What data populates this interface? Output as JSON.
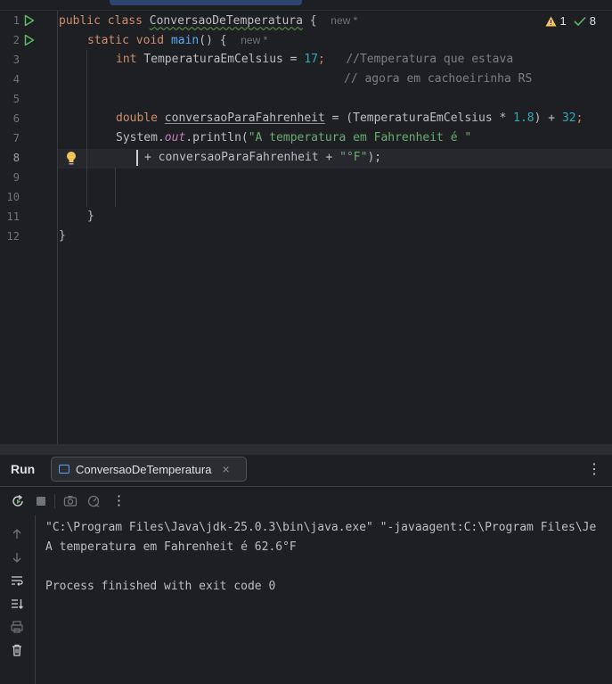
{
  "editor": {
    "line_numbers": [
      "1",
      "2",
      "3",
      "4",
      "5",
      "6",
      "7",
      "8",
      "9",
      "10",
      "11",
      "12"
    ],
    "current_line": "8",
    "lines": {
      "l1": {
        "kw_public": "public",
        "kw_class": "class",
        "class_name": "ConversaoDeTemperatura",
        "brace": "{",
        "hint": "new *"
      },
      "l2": {
        "kw_static": "static",
        "kw_void": "void",
        "method": "main",
        "rest": "() {",
        "hint": "new *"
      },
      "l3": {
        "kw_int": "int",
        "var": "TemperaturaEmCelsius",
        "eq": " = ",
        "num": "17",
        "semi": ";",
        "comment": "//Temperatura que estava"
      },
      "l4": {
        "comment": "// agora em cachoeirinha RS"
      },
      "l6": {
        "kw_double": "double",
        "var": "conversaoParaFahrenheit",
        "eq": " = (",
        "var2": "TemperaturaEmCelsius",
        "op": " * ",
        "num1": "1.8",
        "mid": ") + ",
        "num2": "32",
        "semi": ";"
      },
      "l7": {
        "sys": "System.",
        "out": "out",
        "println": ".println(",
        "str": "\"A temperatura em Fahrenheit é \""
      },
      "l8": {
        "plus": "+ conversaoParaFahrenheit + ",
        "str": "\"°F\"",
        "end": ");"
      },
      "l11": {
        "brace": "}"
      },
      "l12": {
        "brace": "}"
      }
    },
    "inspections": {
      "warnings": "1",
      "ok": "8"
    }
  },
  "run_panel": {
    "title": "Run",
    "tab_label": "ConversaoDeTemperatura",
    "tab_close": "×",
    "more": "⋮",
    "console": [
      "\"C:\\Program Files\\Java\\jdk-25.0.3\\bin\\java.exe\" \"-javaagent:C:\\Program Files\\Je",
      "A temperatura em Fahrenheit é 62.6°F",
      "",
      "Process finished with exit code 0"
    ]
  },
  "colors": {
    "bg": "#1e1f22",
    "keyword": "#cf8e6d",
    "string": "#6aab73",
    "number": "#2aacb8",
    "method": "#56a8f5",
    "comment": "#7a7e85",
    "run_green": "#5fb865"
  },
  "icons": [
    "run-gutter-icon",
    "intention-bulb-icon",
    "warning-icon",
    "check-icon",
    "rerun-icon",
    "stop-icon",
    "camera-icon",
    "settings-icon",
    "more-icon",
    "scroll-up-icon",
    "scroll-down-icon",
    "soft-wrap-icon",
    "scroll-to-end-icon",
    "print-icon",
    "trash-icon",
    "close-icon"
  ]
}
